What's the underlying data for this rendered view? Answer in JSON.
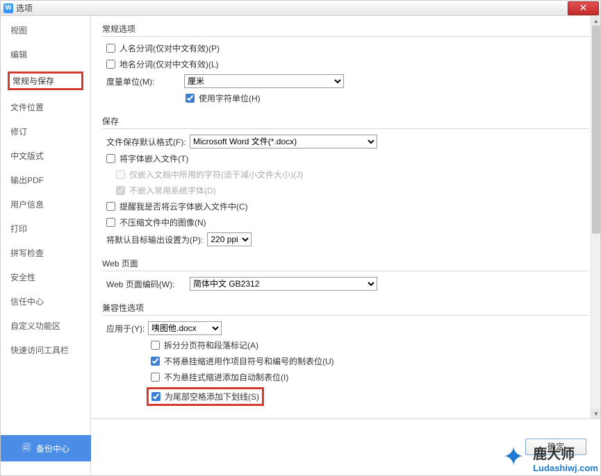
{
  "titlebar": {
    "title": "选项"
  },
  "sidebar": {
    "items": [
      {
        "label": "视图"
      },
      {
        "label": "编辑"
      },
      {
        "label": "常规与保存",
        "selected": true
      },
      {
        "label": "文件位置"
      },
      {
        "label": "修订"
      },
      {
        "label": "中文版式"
      },
      {
        "label": "输出PDF"
      },
      {
        "label": "用户信息"
      },
      {
        "label": "打印"
      },
      {
        "label": "拼写检查"
      },
      {
        "label": "安全性"
      },
      {
        "label": "信任中心"
      },
      {
        "label": "自定义功能区"
      },
      {
        "label": "快速访问工具栏"
      }
    ],
    "backup": "备份中心"
  },
  "general": {
    "title": "常规选项",
    "person_seg": "人名分词(仅对中文有效)(P)",
    "place_seg": "地名分词(仅对中文有效)(L)",
    "unit_label": "度量单位(M):",
    "unit_value": "厘米",
    "use_char_unit": "使用字符单位(H)"
  },
  "save": {
    "title": "保存",
    "format_label": "文件保存默认格式(F):",
    "format_value": "Microsoft Word 文件(*.docx)",
    "embed_fonts": "将字体嵌入文件(T)",
    "embed_only_used": "仅嵌入文档中所用的字符(适于减小文件大小)(J)",
    "no_embed_sys": "不嵌入常用系统字体(D)",
    "remind_cloud": "提醒我是否将云字体嵌入文件中(C)",
    "no_compress": "不压缩文件中的图像(N)",
    "target_output_label": "将默认目标输出设置为(P):",
    "target_output_value": "220 ppi"
  },
  "web": {
    "title": "Web 页面",
    "encoding_label": "Web 页面编码(W):",
    "encoding_value": "简体中文 GB2312"
  },
  "compat": {
    "title": "兼容性选项",
    "apply_to_label": "应用于(Y):",
    "apply_to_value": "咦图他.docx",
    "split_page": "拆分分页符和段落标记(A)",
    "no_hanging_tab": "不将悬挂缩进用作项目符号和编号的制表位(U)",
    "no_auto_tab_hanging": "不为悬挂式缩进添加自动制表位(I)",
    "trailing_underline": "为尾部空格添加下划线(S)"
  },
  "footer": {
    "ok": "确定"
  },
  "watermark": {
    "title": "鹿大师",
    "url": "Ludashiwj.com"
  }
}
